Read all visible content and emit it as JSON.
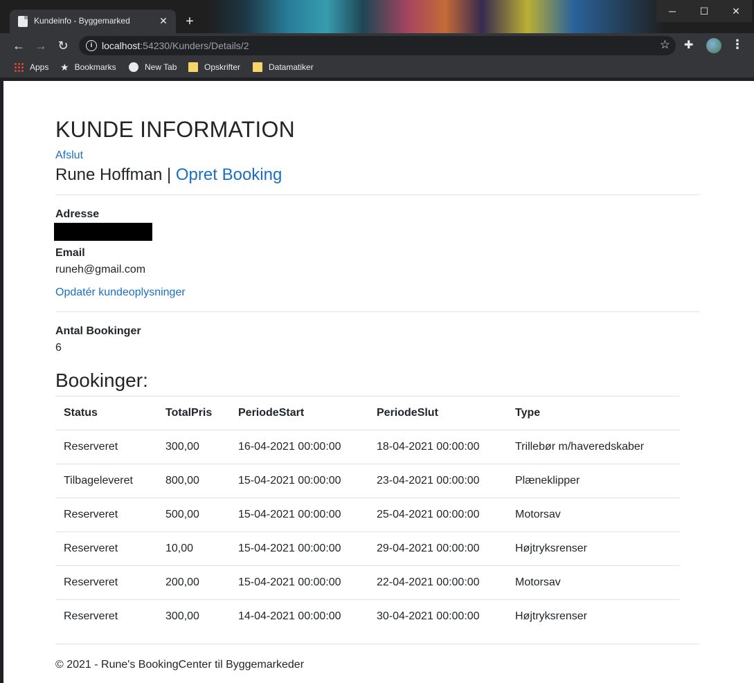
{
  "browser": {
    "tab_title": "Kundeinfo - Byggemarked",
    "tab_close": "✕",
    "new_tab": "+",
    "url_host": "localhost",
    "url_rest": ":54230/Kunders/Details/2",
    "window_min": "─",
    "window_max": "☐",
    "window_close": "✕",
    "bookmarks": [
      {
        "label": "Apps",
        "icon": "apps-grid-icon"
      },
      {
        "label": "Bookmarks",
        "icon": "star-icon"
      },
      {
        "label": "New Tab",
        "icon": "globe-icon"
      },
      {
        "label": "Opskrifter",
        "icon": "folder-icon"
      },
      {
        "label": "Datamatiker",
        "icon": "folder-icon"
      }
    ]
  },
  "page": {
    "heading": "KUNDE INFORMATION",
    "afslut": "Afslut",
    "customer_name": "Rune Hoffman",
    "separator": "|",
    "opret_booking": "Opret Booking",
    "adresse_label": "Adresse",
    "email_label": "Email",
    "email_value": "runeh@gmail.com",
    "update_link": "Opdatér kundeoplysninger",
    "antal_label": "Antal Bookinger",
    "antal_value": "6",
    "bookings_heading": "Bookinger:",
    "table": {
      "headers": [
        "Status",
        "TotalPris",
        "PeriodeStart",
        "PeriodeSlut",
        "Type"
      ],
      "rows": [
        [
          "Reserveret",
          "300,00",
          "16-04-2021 00:00:00",
          "18-04-2021 00:00:00",
          "Trillebør m/haveredskaber"
        ],
        [
          "Tilbageleveret",
          "800,00",
          "15-04-2021 00:00:00",
          "23-04-2021 00:00:00",
          "Plæneklipper"
        ],
        [
          "Reserveret",
          "500,00",
          "15-04-2021 00:00:00",
          "25-04-2021 00:00:00",
          "Motorsav"
        ],
        [
          "Reserveret",
          "10,00",
          "15-04-2021 00:00:00",
          "29-04-2021 00:00:00",
          "Højtryksrenser"
        ],
        [
          "Reserveret",
          "200,00",
          "15-04-2021 00:00:00",
          "22-04-2021 00:00:00",
          "Motorsav"
        ],
        [
          "Reserveret",
          "300,00",
          "14-04-2021 00:00:00",
          "30-04-2021 00:00:00",
          "Højtryksrenser"
        ]
      ]
    },
    "footer": "© 2021 - Rune's BookingCenter til Byggemarkeder"
  }
}
